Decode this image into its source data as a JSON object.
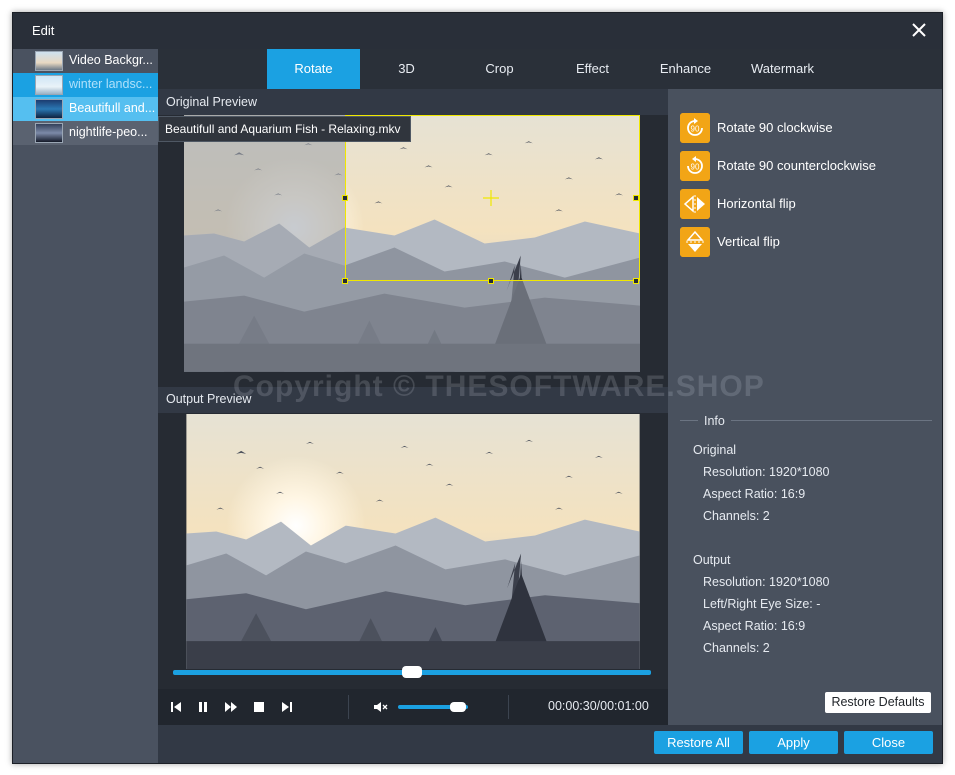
{
  "window": {
    "title": "Edit"
  },
  "files": [
    {
      "name": "Video Backgr...",
      "state": "normal"
    },
    {
      "name": "winter landsc...",
      "state": "hover"
    },
    {
      "name": "Beautifull and...",
      "state": "selected"
    },
    {
      "name": "nightlife-peo...",
      "state": "normal"
    }
  ],
  "tooltip": "Beautifull and Aquarium Fish - Relaxing.mkv",
  "tabs": [
    {
      "label": "Rotate",
      "active": true
    },
    {
      "label": "3D",
      "active": false
    },
    {
      "label": "Crop",
      "active": false
    },
    {
      "label": "Effect",
      "active": false
    },
    {
      "label": "Enhance",
      "active": false
    },
    {
      "label": "Watermark",
      "active": false
    }
  ],
  "preview": {
    "original_label": "Original Preview",
    "output_label": "Output Preview",
    "watermark": "Copyright © THESOFTWARE.SHOP"
  },
  "player": {
    "progress_fraction": 0.5,
    "volume_fraction": 0.85,
    "time": "00:00:30/00:01:00"
  },
  "actions": [
    {
      "label": "Rotate 90 clockwise",
      "icon": "rotate-cw-icon"
    },
    {
      "label": "Rotate 90 counterclockwise",
      "icon": "rotate-ccw-icon"
    },
    {
      "label": "Horizontal flip",
      "icon": "flip-horizontal-icon"
    },
    {
      "label": "Vertical flip",
      "icon": "flip-vertical-icon"
    }
  ],
  "info": {
    "title": "Info",
    "original": {
      "heading": "Original",
      "resolution": "Resolution: 1920*1080",
      "aspect": "Aspect Ratio: 16:9",
      "channels": "Channels: 2"
    },
    "output": {
      "heading": "Output",
      "resolution": "Resolution: 1920*1080",
      "eye_size": "Left/Right Eye Size: -",
      "aspect": "Aspect Ratio: 16:9",
      "channels": "Channels: 2"
    }
  },
  "buttons": {
    "restore_defaults": "Restore Defaults",
    "restore_all": "Restore All",
    "apply": "Apply",
    "close": "Close"
  },
  "colors": {
    "accent": "#1ba1e2",
    "icon_orange": "#f2a516",
    "crop_frame": "#f0e800"
  }
}
